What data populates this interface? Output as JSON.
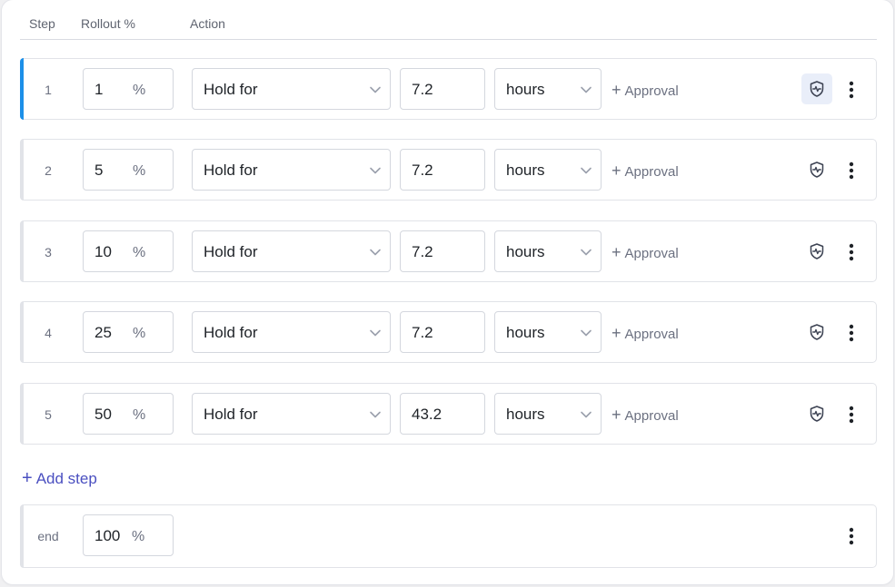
{
  "header": {
    "step": "Step",
    "rollout": "Rollout %",
    "action": "Action"
  },
  "steps": [
    {
      "num": "1",
      "rollout": "1",
      "percent_sign": "%",
      "action": "Hold for",
      "duration": "7.2",
      "unit": "hours",
      "approval": "Approval",
      "active": true
    },
    {
      "num": "2",
      "rollout": "5",
      "percent_sign": "%",
      "action": "Hold for",
      "duration": "7.2",
      "unit": "hours",
      "approval": "Approval",
      "active": false
    },
    {
      "num": "3",
      "rollout": "10",
      "percent_sign": "%",
      "action": "Hold for",
      "duration": "7.2",
      "unit": "hours",
      "approval": "Approval",
      "active": false
    },
    {
      "num": "4",
      "rollout": "25",
      "percent_sign": "%",
      "action": "Hold for",
      "duration": "7.2",
      "unit": "hours",
      "approval": "Approval",
      "active": false
    },
    {
      "num": "5",
      "rollout": "50",
      "percent_sign": "%",
      "action": "Hold for",
      "duration": "43.2",
      "unit": "hours",
      "approval": "Approval",
      "active": false
    }
  ],
  "add_step": "Add step",
  "end": {
    "label": "end",
    "rollout": "100",
    "percent_sign": "%"
  },
  "icons": {
    "health": "shield-pulse-icon",
    "menu": "kebab-menu-icon",
    "chevron": "chevron-down-icon",
    "plus": "plus-icon"
  },
  "colors": {
    "active_accent": "#1c8fe8",
    "link": "#4a4fc0",
    "active_icon_bg": "#e9eef9"
  }
}
